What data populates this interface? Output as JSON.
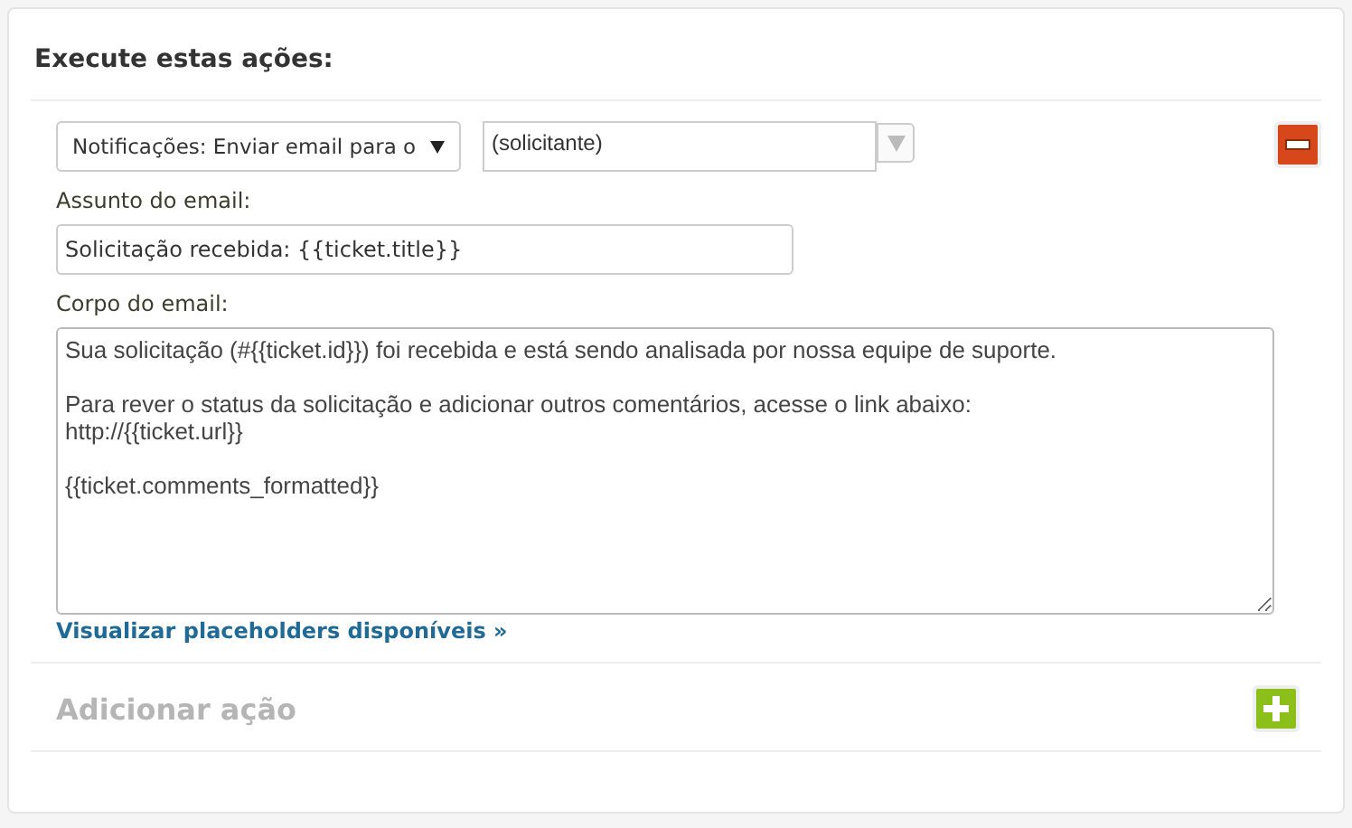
{
  "title": "Execute estas ações:",
  "action": {
    "type_select": "Notificações: Enviar email para o",
    "recipient": "(solicitante)",
    "subject_label": "Assunto do email:",
    "subject": "Solicitação recebida: {{ticket.title}}",
    "body_label": "Corpo do email:",
    "body": "Sua solicitação (#{{ticket.id}}) foi recebida e está sendo analisada por nossa equipe de suporte.\n\nPara rever o status da solicitação e adicionar outros comentários, acesse o link abaixo:\nhttp://{{ticket.url}}\n\n{{ticket.comments_formatted}}",
    "link": "Visualizar placeholders disponíveis »"
  },
  "add_action": {
    "label": "Adicionar ação",
    "disabled": true
  }
}
